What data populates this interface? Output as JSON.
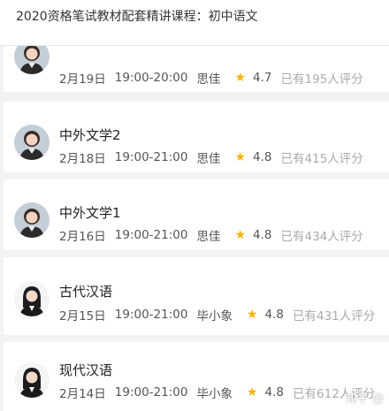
{
  "header": {
    "title": "2020资格笔试教材配套精讲课程：初中语文"
  },
  "courses": [
    {
      "title": "",
      "date": "2月19日",
      "time": "19:00-20:00",
      "teacher": "思佳",
      "rating": "4.7",
      "reviews": "已有195人评分",
      "avatar": "teacher-sijia"
    },
    {
      "title": "中外文学2",
      "date": "2月18日",
      "time": "19:00-21:00",
      "teacher": "思佳",
      "rating": "4.8",
      "reviews": "已有415人评分",
      "avatar": "teacher-sijia"
    },
    {
      "title": "中外文学1",
      "date": "2月16日",
      "time": "19:00-21:00",
      "teacher": "思佳",
      "rating": "4.8",
      "reviews": "已有434人评分",
      "avatar": "teacher-sijia"
    },
    {
      "title": "古代汉语",
      "date": "2月15日",
      "time": "19:00-21:00",
      "teacher": "毕小象",
      "rating": "4.8",
      "reviews": "已有431人评分",
      "avatar": "teacher-bixiaoxiang"
    },
    {
      "title": "现代汉语",
      "date": "2月14日",
      "time": "19:00-21:00",
      "teacher": "毕小象",
      "rating": "4.8",
      "reviews": "已有612人评分",
      "avatar": "teacher-bixiaoxiang"
    }
  ],
  "icons": {
    "star": "star-icon",
    "star_color": "#f5b400"
  },
  "watermark": "知乎 @"
}
